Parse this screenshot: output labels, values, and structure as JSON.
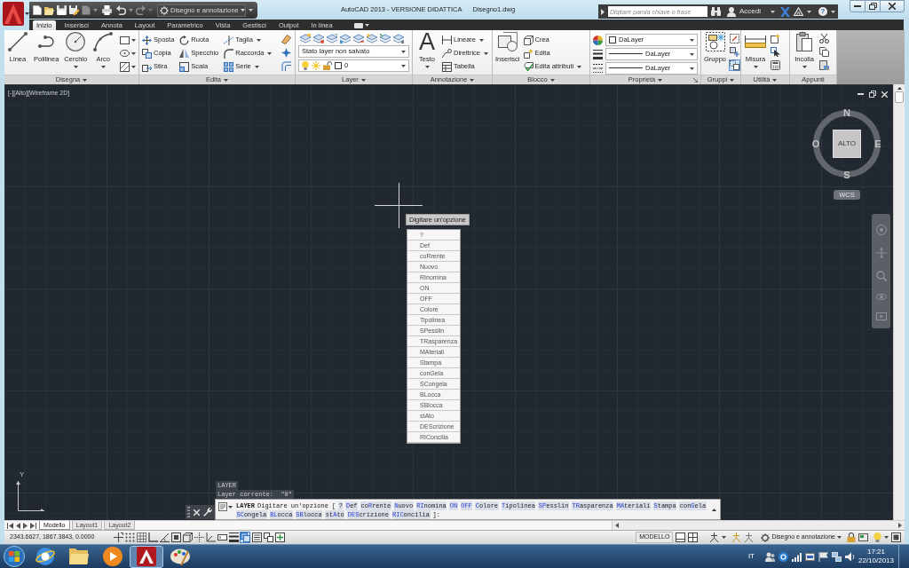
{
  "title_bar": {
    "workspace": "Disegno e annotazione",
    "title": "AutoCAD 2013 - VERSIONE DIDATTICA",
    "document": "Disegno1.dwg",
    "search": {
      "placeholder": "Digitare parola chiave o frase"
    },
    "sign_in": "Accedi",
    "help": "?"
  },
  "ribbon": {
    "tabs": [
      {
        "label": "Inizio",
        "selected": true
      },
      {
        "label": "Inserisci",
        "selected": false
      },
      {
        "label": "Annota",
        "selected": false
      },
      {
        "label": "Layout",
        "selected": false
      },
      {
        "label": "Parametrico",
        "selected": false
      },
      {
        "label": "Vista",
        "selected": false
      },
      {
        "label": "Gestisci",
        "selected": false
      },
      {
        "label": "Output",
        "selected": false
      },
      {
        "label": "In linea",
        "selected": false
      }
    ],
    "panels": [
      {
        "kind": "draw",
        "title": "Disegna",
        "menu": true,
        "tools": [
          {
            "label": "Linea",
            "menu": false
          },
          {
            "label": "Polilinea",
            "menu": false
          },
          {
            "label": "Cerchio",
            "menu": true
          },
          {
            "label": "Arco",
            "menu": true
          }
        ]
      },
      {
        "kind": "modify",
        "title": "Edita",
        "menu": true,
        "tools": [
          {
            "label": "Sposta",
            "menu": false
          },
          {
            "label": "Ruota",
            "menu": false
          },
          {
            "label": "Taglia",
            "menu": true
          },
          {
            "label": "Copia",
            "menu": false
          },
          {
            "label": "Specchio",
            "menu": false
          },
          {
            "label": "Raccorda",
            "menu": true
          },
          {
            "label": "Stira",
            "menu": false
          },
          {
            "label": "Scala",
            "menu": false
          },
          {
            "label": "Serie",
            "menu": true
          }
        ]
      },
      {
        "kind": "layers",
        "title": "Layer",
        "menu": true,
        "layer_state": "Stato layer non salvato",
        "current_layer": "0"
      },
      {
        "kind": "annotation",
        "title": "Annotazione",
        "menu": true,
        "main": {
          "icon": "A",
          "label": "Testo",
          "menu": true
        },
        "tools": [
          {
            "label": "Lineare",
            "menu": true
          },
          {
            "label": "Direttrice",
            "menu": true
          },
          {
            "label": "Tabella",
            "menu": false
          }
        ]
      },
      {
        "kind": "block",
        "title": "Blocco",
        "menu": true,
        "main": {
          "label": "Inserisci",
          "menu": false
        },
        "tools": [
          {
            "label": "Crea",
            "menu": false
          },
          {
            "label": "Edita",
            "menu": false
          },
          {
            "label": "Edita attributi",
            "menu": true
          }
        ]
      },
      {
        "kind": "properties",
        "title": "Proprietà",
        "menu": true,
        "rows": [
          {
            "value": "DaLayer"
          },
          {
            "value": "DaLayer"
          },
          {
            "value": "DaLayer"
          }
        ]
      },
      {
        "kind": "groups",
        "title": "Gruppi",
        "menu": true,
        "main": {
          "label": "Gruppo",
          "menu": false
        },
        "tools": [
          {
            "selected": false
          },
          {
            "selected": false
          },
          {
            "selected": true
          }
        ]
      },
      {
        "kind": "utilities",
        "title": "Utilità",
        "menu": true,
        "main": {
          "label": "Misura",
          "menu": true
        }
      },
      {
        "kind": "clipboard",
        "title": "Appunti",
        "menu": false,
        "main": {
          "label": "Incolla",
          "menu": true
        }
      }
    ]
  },
  "viewport": {
    "label": "[-][Alto][Wireframe 2D]",
    "viewcube": {
      "north": "N",
      "east": "E",
      "south": "S",
      "west": "O",
      "face": "ALTO",
      "coordinate_system": "WCS"
    },
    "ucs_icon": {
      "y_label": "Y"
    },
    "option_menu": {
      "title": "Digitare un'opzione",
      "options": [
        "?",
        "Def",
        "coRrente",
        "Nuovo",
        "RInomina",
        "ON",
        "OFF",
        "Colore",
        "Tipolinea",
        "SPesslin",
        "TRasparenza",
        "MAteriali",
        "Stampa",
        "conGela",
        "SCongela",
        "BLocca",
        "SBlocca",
        "stAto",
        "DEScrizione",
        "RIConcilia"
      ]
    }
  },
  "command_line": {
    "history": [
      "LAYER",
      "Layer corrente:  \"0\""
    ],
    "command": "LAYER",
    "prompt": "Digitare un'opzione [",
    "options": [
      "?",
      "Def",
      "coRrente",
      "Nuovo",
      "RInomina",
      "ON",
      "OFF",
      "Colore",
      "Tipolinea",
      "SPesslin",
      "TRasparenza",
      "MAteriali",
      "Stampa",
      "conGela",
      "SCongela",
      "BLocca",
      "SBlocca",
      "stAto",
      "DEScrizione",
      "RIConcilia"
    ],
    "prompt_end": "]:"
  },
  "layout_tabs": [
    {
      "label": "Modello",
      "selected": true
    },
    {
      "label": "Layout1",
      "selected": false
    },
    {
      "label": "Layout2",
      "selected": false
    }
  ],
  "status_bar": {
    "coordinates": "2343.6627, 1867.3843, 0.0000",
    "toggles": [
      {
        "on": false
      },
      {
        "on": false
      },
      {
        "on": false
      },
      {
        "on": false
      },
      {
        "on": false
      },
      {
        "on": false
      },
      {
        "on": false
      },
      {
        "on": false
      },
      {
        "on": false
      },
      {
        "on": false
      },
      {
        "on": false
      },
      {
        "on": true
      },
      {
        "on": false
      },
      {
        "on": false
      },
      {
        "on": false
      }
    ],
    "space": "MODELLO",
    "workspace": "Disegno e annotazione"
  },
  "taskbar": {
    "apps": [
      {
        "selected": false
      },
      {
        "selected": false
      },
      {
        "selected": false
      },
      {
        "selected": true
      },
      {
        "selected": false
      }
    ],
    "language": "IT",
    "time": "17:21",
    "date": "22/10/2013"
  }
}
